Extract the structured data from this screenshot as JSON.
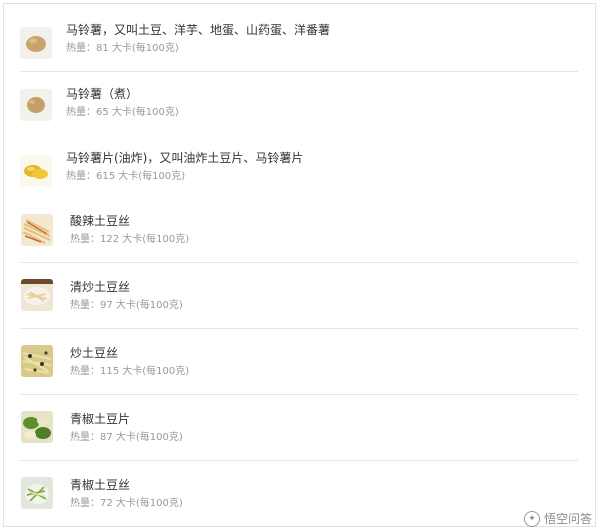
{
  "items": [
    {
      "name": "马铃薯，又叫土豆、洋芋、地蛋、山药蛋、洋番薯",
      "calories": "热量：81 大卡(每100克)",
      "icon": "potato-icon"
    },
    {
      "name": "马铃薯（煮）",
      "calories": "热量：65 大卡(每100克)",
      "icon": "boiled-potato-icon"
    },
    {
      "name": "马铃薯片(油炸)，又叫油炸土豆片、马铃薯片",
      "calories": "热量：615 大卡(每100克)",
      "icon": "potato-chips-icon"
    },
    {
      "name": "酸辣土豆丝",
      "calories": "热量：122 大卡(每100克)",
      "icon": "hot-sour-potato-shreds-icon"
    },
    {
      "name": "清炒土豆丝",
      "calories": "热量：97 大卡(每100克)",
      "icon": "stir-fried-potato-shreds-icon"
    },
    {
      "name": "炒土豆丝",
      "calories": "热量：115 大卡(每100克)",
      "icon": "fried-potato-shreds-icon"
    },
    {
      "name": "青椒土豆片",
      "calories": "热量：87 大卡(每100克)",
      "icon": "green-pepper-potato-slices-icon"
    },
    {
      "name": "青椒土豆丝",
      "calories": "热量：72 大卡(每100克)",
      "icon": "green-pepper-potato-shreds-icon"
    }
  ],
  "watermark": {
    "text": "悟空问答"
  }
}
